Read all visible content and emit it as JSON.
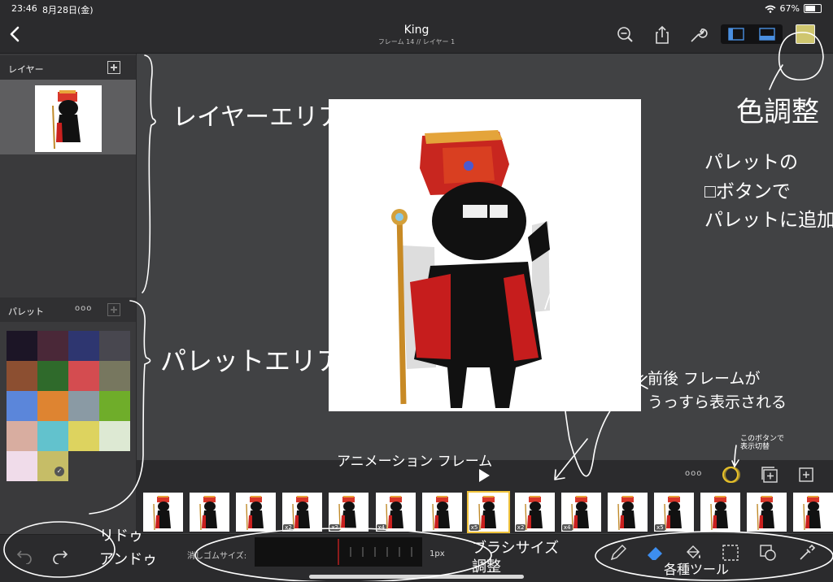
{
  "status": {
    "time": "23:46",
    "date": "8月28日(金)",
    "battery": "67%"
  },
  "nav": {
    "title": "King",
    "subtitle": "フレーム 14 // レイヤー 1"
  },
  "colors": {
    "current": "#cfc66f",
    "selected_frame": "#f0c23a"
  },
  "layers": {
    "label": "レイヤー"
  },
  "palette": {
    "label": "パレット",
    "more": "ooo",
    "swatches": [
      "#1c1526",
      "#4a2838",
      "#2e3670",
      "#48474f",
      "#8c4f31",
      "#2f6a2b",
      "#d44c50",
      "#77775f",
      "#5b86da",
      "#de8431",
      "#8a9aa4",
      "#6fad2a",
      "#d8ada0",
      "#62c2cd",
      "#ddd35f",
      "#dde9d3",
      "#f0dcea",
      "#c6bd67"
    ],
    "selected_index": 17
  },
  "animation": {
    "more": "ooo",
    "frames": [
      {
        "badge": ""
      },
      {
        "badge": ""
      },
      {
        "badge": ""
      },
      {
        "badge": "x2"
      },
      {
        "badge": "x2"
      },
      {
        "badge": "x4"
      },
      {
        "badge": ""
      },
      {
        "badge": "x5"
      },
      {
        "badge": "x2"
      },
      {
        "badge": "x4"
      },
      {
        "badge": ""
      },
      {
        "badge": "x5"
      },
      {
        "badge": ""
      },
      {
        "badge": ""
      },
      {
        "badge": ""
      }
    ],
    "selected_index": 7
  },
  "toolbar": {
    "eraser_label": "消しゴムサイズ:",
    "size_value": "1px"
  },
  "annotations": {
    "layer_area": "レイヤーエリア",
    "color_adjust": "色調整",
    "palette_note": "パレットの\n□ボタンで\nパレットに追加",
    "palette_area": "パレットエリア",
    "onion": "前後 フレームが\nうっすら表示される",
    "toggle": "このボタンで\n表示切替",
    "anim_frame": "アニメーション フレーム",
    "undo_redo": "リドゥ\nアンドゥ",
    "brush_size": "ブラシサイズ\n調整",
    "tools": "各種ツール"
  }
}
